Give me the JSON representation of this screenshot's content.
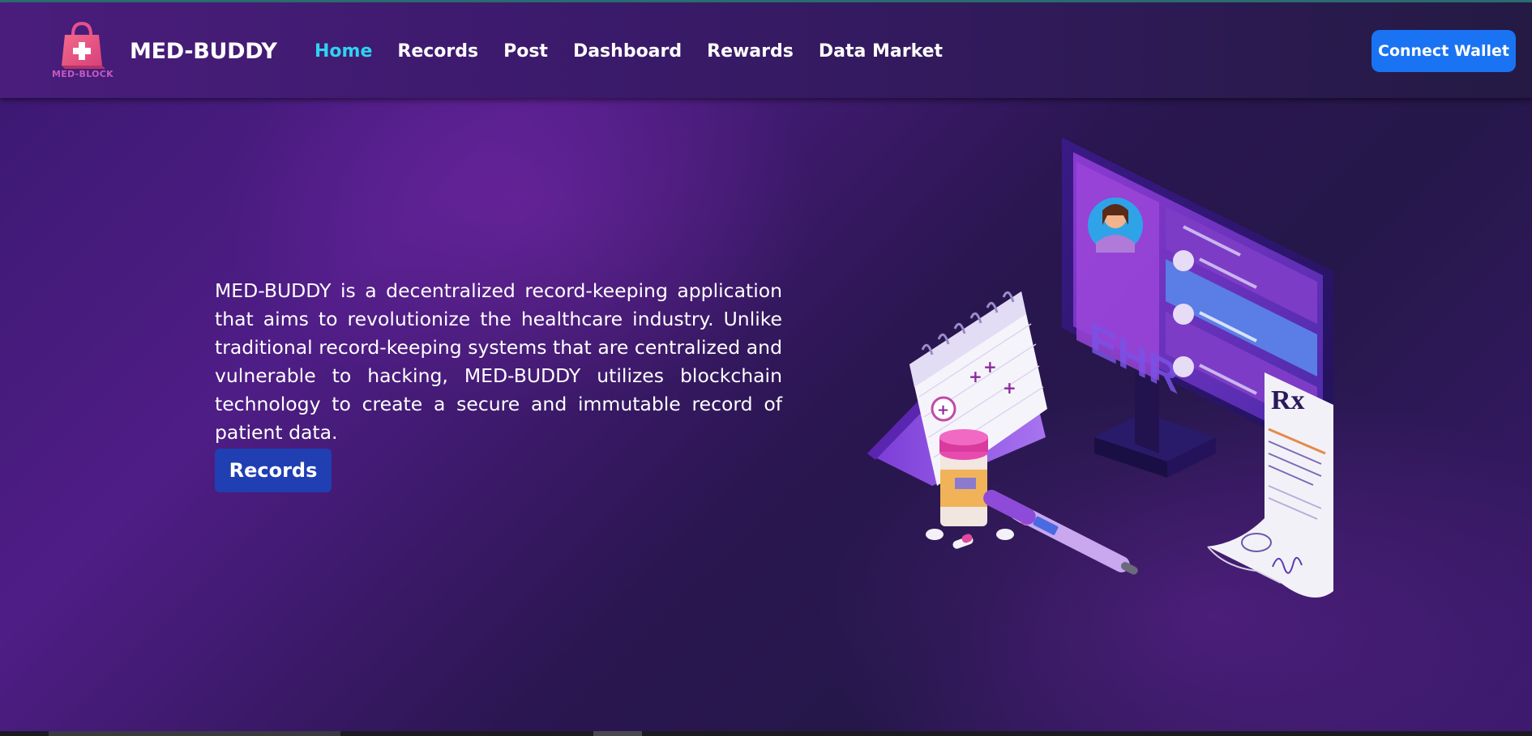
{
  "navbar": {
    "logo_text": "MED-BLOCK",
    "brand": "MED-BUDDY",
    "links": [
      "Home",
      "Records",
      "Post",
      "Dashboard",
      "Rewards",
      "Data Market"
    ],
    "active_link": "Home",
    "connect_wallet_label": "Connect Wallet"
  },
  "hero": {
    "description": "MED-BUDDY is a decentralized record-keeping application that aims to revolutionize the healthcare industry. Unlike traditional record-keeping systems that are centralized and vulnerable to hacking, MED-BUDDY utilizes blockchain technology to create a secure and immutable record of patient data.",
    "records_button_label": "Records"
  },
  "illustration": {
    "monitor_label": "EHR",
    "prescription_symbol": "Rx"
  },
  "colors": {
    "active_link": "#2fd3f0",
    "wallet_button": "#1a73f2",
    "records_button": "#1f3fb2",
    "logo_pink": "#e8508a"
  }
}
